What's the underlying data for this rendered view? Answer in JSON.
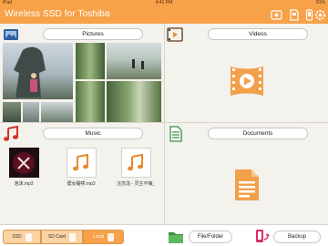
{
  "status_bar": {
    "carrier": "iPad",
    "wifi_icon": "wifi-icon",
    "time": "4:41 PM",
    "battery": "81%"
  },
  "app": {
    "title": "Wireless SSD for Toshiba"
  },
  "toolbar_icons": [
    "drive-settings-icon",
    "sd-card-icon",
    "phone-icon",
    "settings-icon"
  ],
  "panels": {
    "pictures": {
      "label": "Pictures",
      "icon": "photo-icon"
    },
    "videos": {
      "label": "Videos",
      "icon": "film-icon"
    },
    "music": {
      "label": "Music",
      "icon": "music-note-icon",
      "items": [
        {
          "name": "泡沫.mp3",
          "thumb": "album-art"
        },
        {
          "name": "儂女睡嗦.mp3",
          "thumb": "music-note"
        },
        {
          "name": "汪苏泷 - 灵主不悔_...",
          "thumb": "music-note"
        }
      ]
    },
    "documents": {
      "label": "Documents",
      "icon": "document-icon"
    }
  },
  "bottom_bar": {
    "segments": [
      {
        "label": "SSD",
        "active": false
      },
      {
        "label": "SD Card",
        "active": false
      },
      {
        "label": "Local",
        "active": true
      }
    ],
    "file_folder_label": "File/Folder",
    "backup_label": "Backup"
  },
  "colors": {
    "accent": "#f7a148",
    "accent_light": "#fbd3a4",
    "music_red": "#d6302a",
    "doc_green": "#3b8f3e"
  }
}
